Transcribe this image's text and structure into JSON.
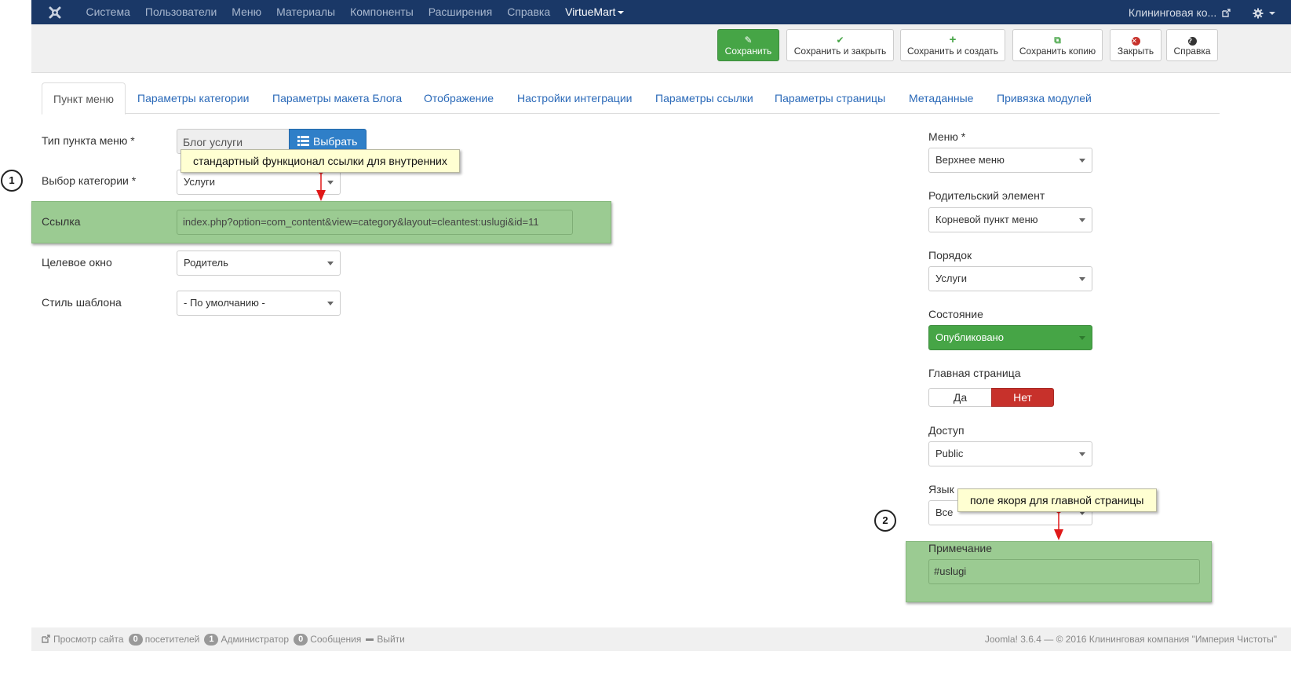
{
  "navbar": {
    "logo_icon": "joomla-logo-icon",
    "items": [
      "Система",
      "Пользователи",
      "Меню",
      "Материалы",
      "Компоненты",
      "Расширения",
      "Справка"
    ],
    "virtuemart": "VirtueMart",
    "site_name": "Клининговая ко...",
    "settings_icon": "gear-icon"
  },
  "toolbar": {
    "save": "Сохранить",
    "save_close": "Сохранить и закрыть",
    "save_new": "Сохранить и создать",
    "save_copy": "Сохранить копию",
    "close": "Закрыть",
    "help": "Справка"
  },
  "tabs": [
    "Пункт меню",
    "Параметры категории",
    "Параметры макета Блога",
    "Отображение",
    "Настройки интеграции",
    "Параметры ссылки",
    "Параметры страницы",
    "Метаданные",
    "Привязка модулей"
  ],
  "form": {
    "type_label": "Тип пункта меню *",
    "type_value": "Блог услуги",
    "select_button": "Выбрать",
    "category_label": "Выбор категории *",
    "category_value": "Услуги",
    "link_label": "Ссылка",
    "link_value": "index.php?option=com_content&view=category&layout=cleantest:uslugi&id=11",
    "target_label": "Целевое окно",
    "target_value": "Родитель",
    "style_label": "Стиль шаблона",
    "style_value": "- По умолчанию -"
  },
  "side": {
    "menu_label": "Меню *",
    "menu_value": "Верхнее меню",
    "parent_label": "Родительский элемент",
    "parent_value": "Корневой пункт меню",
    "order_label": "Порядок",
    "order_value": "Услуги",
    "state_label": "Состояние",
    "state_value": "Опубликовано",
    "home_label": "Главная страница",
    "home_yes": "Да",
    "home_no": "Нет",
    "access_label": "Доступ",
    "access_value": "Public",
    "lang_label": "Язык",
    "lang_value": "Все",
    "note_label": "Примечание",
    "note_value": "#uslugi"
  },
  "annotations": {
    "tip1": "стандартный функционал ссылки для внутренних",
    "tip2": "поле якоря для главной страницы",
    "num1": "1",
    "num2": "2"
  },
  "footer": {
    "view_site": "Просмотр сайта",
    "visitors_count": "0",
    "visitors": "посетителей",
    "admin_count": "1",
    "admin": "Администратор",
    "messages_count": "0",
    "messages": "Сообщения",
    "logout": "Выйти",
    "copyright": "Joomla! 3.6.4  —  © 2016 Клининговая компания \"Империя Чистоты\""
  },
  "colors": {
    "navbar": "#1a3867",
    "save_green": "#46a546",
    "highlight_green": "#9bcb92",
    "no_red": "#c7312b",
    "tab_link": "#2a69b8"
  }
}
